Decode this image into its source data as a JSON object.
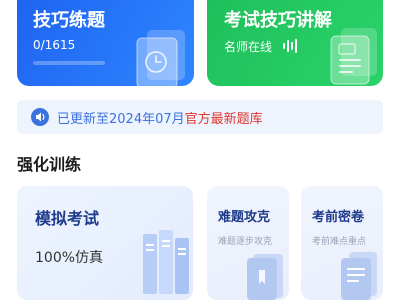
{
  "top_cards": {
    "practice": {
      "title": "技巧练题",
      "progress_text": "0/1615",
      "progress": 0
    },
    "lecture": {
      "title": "考试技巧讲解",
      "subtitle": "名师在线"
    }
  },
  "notice": {
    "text": "已更新至2024年07月",
    "highlight": "官方最新题库"
  },
  "section": {
    "title": "强化训练"
  },
  "training": {
    "mock_exam": {
      "title": "模拟考试",
      "subtitle": "100%仿真"
    },
    "hard_questions": {
      "title": "难题攻克",
      "subtitle": "难题逐步攻克"
    },
    "pre_exam": {
      "title": "考前密卷",
      "subtitle": "考前难点重点"
    }
  },
  "colors": {
    "blue_card": "#2f86ff",
    "green_card": "#2ad36a",
    "notice_bg": "#eef4fd",
    "notice_text": "#3b72e0",
    "highlight_red": "#e0372f"
  },
  "icons": {
    "practice_card": "clock-document-icon",
    "lecture_card": "audio-wave-icon",
    "lecture_illustration": "document-icon",
    "notice": "speaker-icon",
    "mock_exam": "books-icon",
    "hard_questions": "book-icon",
    "pre_exam": "document-stack-icon"
  }
}
